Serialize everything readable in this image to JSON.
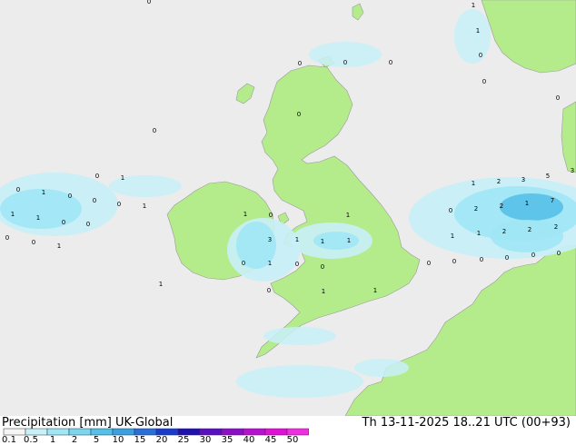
{
  "footer": {
    "left_title": "Precipitation [mm] UK-Global",
    "right_title": "Th 13-11-2025 18..21 UTC (00+93)"
  },
  "colorbar": {
    "labels": [
      "0.1",
      "0.5",
      "1",
      "2",
      "5",
      "10",
      "15",
      "20",
      "25",
      "30",
      "35",
      "40",
      "45",
      "50"
    ],
    "colors": [
      "#f5f5f5",
      "#c8f0f8",
      "#a0e6f5",
      "#7dd5f0",
      "#56c0e8",
      "#3c9fe0",
      "#2a6fd8",
      "#1a3ccc",
      "#2010b0",
      "#5a10c0",
      "#8a10c8",
      "#b810d0",
      "#e010d8",
      "#f030e0"
    ]
  },
  "colors": {
    "sea": "#ececec",
    "land": "#b4ec8c",
    "continent": "#b4ec8c",
    "precip_light": "#c8f0f8",
    "precip_medium": "#a0e6f5",
    "precip_heavy": "#56c0e8"
  },
  "map_labels": [
    "0",
    "1",
    "1",
    "0",
    "0",
    "0",
    "0",
    "0",
    "0",
    "0",
    "0",
    "0",
    "1",
    "0",
    "1",
    "0",
    "0",
    "0",
    "1",
    "1",
    "1",
    "0",
    "0",
    "0",
    "0",
    "1",
    "1",
    "0",
    "1",
    "3",
    "1",
    "1",
    "1",
    "0",
    "1",
    "0",
    "0",
    "1",
    "0",
    "1",
    "1",
    "1",
    "2",
    "3",
    "5",
    "3",
    "0",
    "2",
    "2",
    "1",
    "7",
    "1",
    "1",
    "2",
    "2",
    "2",
    "0",
    "0",
    "0",
    "0",
    "0",
    "0"
  ]
}
